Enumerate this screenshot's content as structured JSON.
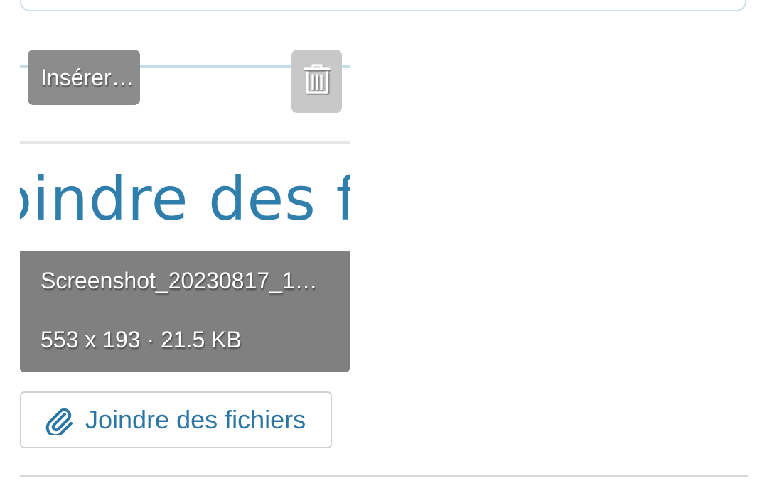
{
  "attachment": {
    "insert_label": "Insérer…",
    "delete_icon": "trash-icon",
    "thumbnail_text": "Joindre des fichiers",
    "file_name": "Screenshot_20230817_1…",
    "file_meta": "553 x 193 · 21.5 KB"
  },
  "attach_button": {
    "label": "Joindre des fichiers",
    "icon": "paperclip-icon"
  },
  "colors": {
    "accent": "#2b76a4",
    "overlay": "#808080",
    "border": "#d0d3d6"
  }
}
